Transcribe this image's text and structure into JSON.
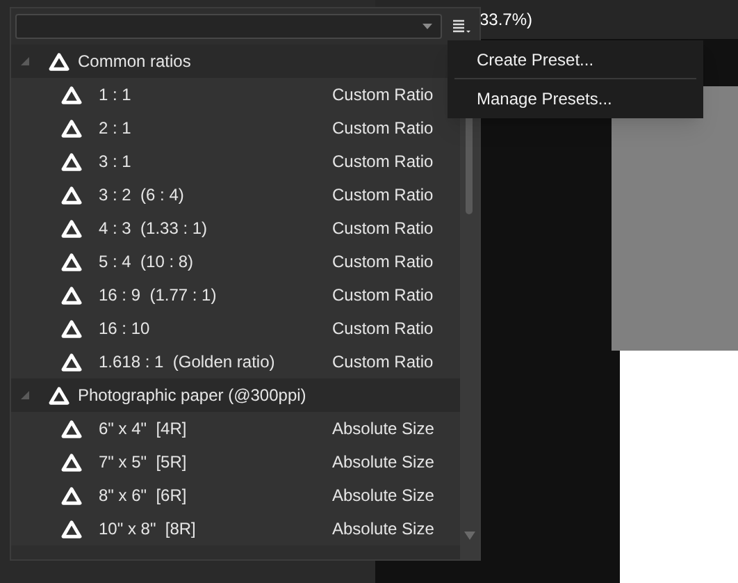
{
  "document_title": {
    "text": "33.7%)"
  },
  "menu": {
    "items": [
      {
        "label": "Create Preset..."
      },
      {
        "label": "Manage Presets..."
      }
    ]
  },
  "preset_groups": [
    {
      "label": "Common ratios",
      "expanded": true,
      "children": [
        {
          "label": "1 : 1",
          "type": "Custom Ratio"
        },
        {
          "label": "2 : 1",
          "type": "Custom Ratio"
        },
        {
          "label": "3 : 1",
          "type": "Custom Ratio"
        },
        {
          "label": "3 : 2  (6 : 4)",
          "type": "Custom Ratio"
        },
        {
          "label": "4 : 3  (1.33 : 1)",
          "type": "Custom Ratio"
        },
        {
          "label": "5 : 4  (10 : 8)",
          "type": "Custom Ratio"
        },
        {
          "label": "16 : 9  (1.77 : 1)",
          "type": "Custom Ratio"
        },
        {
          "label": "16 : 10",
          "type": "Custom Ratio"
        },
        {
          "label": "1.618 : 1  (Golden ratio)",
          "type": "Custom Ratio"
        }
      ]
    },
    {
      "label": "Photographic paper (@300ppi)",
      "expanded": true,
      "children": [
        {
          "label": "6\" x 4\"  [4R]",
          "type": "Absolute Size"
        },
        {
          "label": "7\" x 5\"  [5R]",
          "type": "Absolute Size"
        },
        {
          "label": "8\" x 6\"  [6R]",
          "type": "Absolute Size"
        },
        {
          "label": "10\" x 8\"  [8R]",
          "type": "Absolute Size"
        }
      ]
    }
  ]
}
